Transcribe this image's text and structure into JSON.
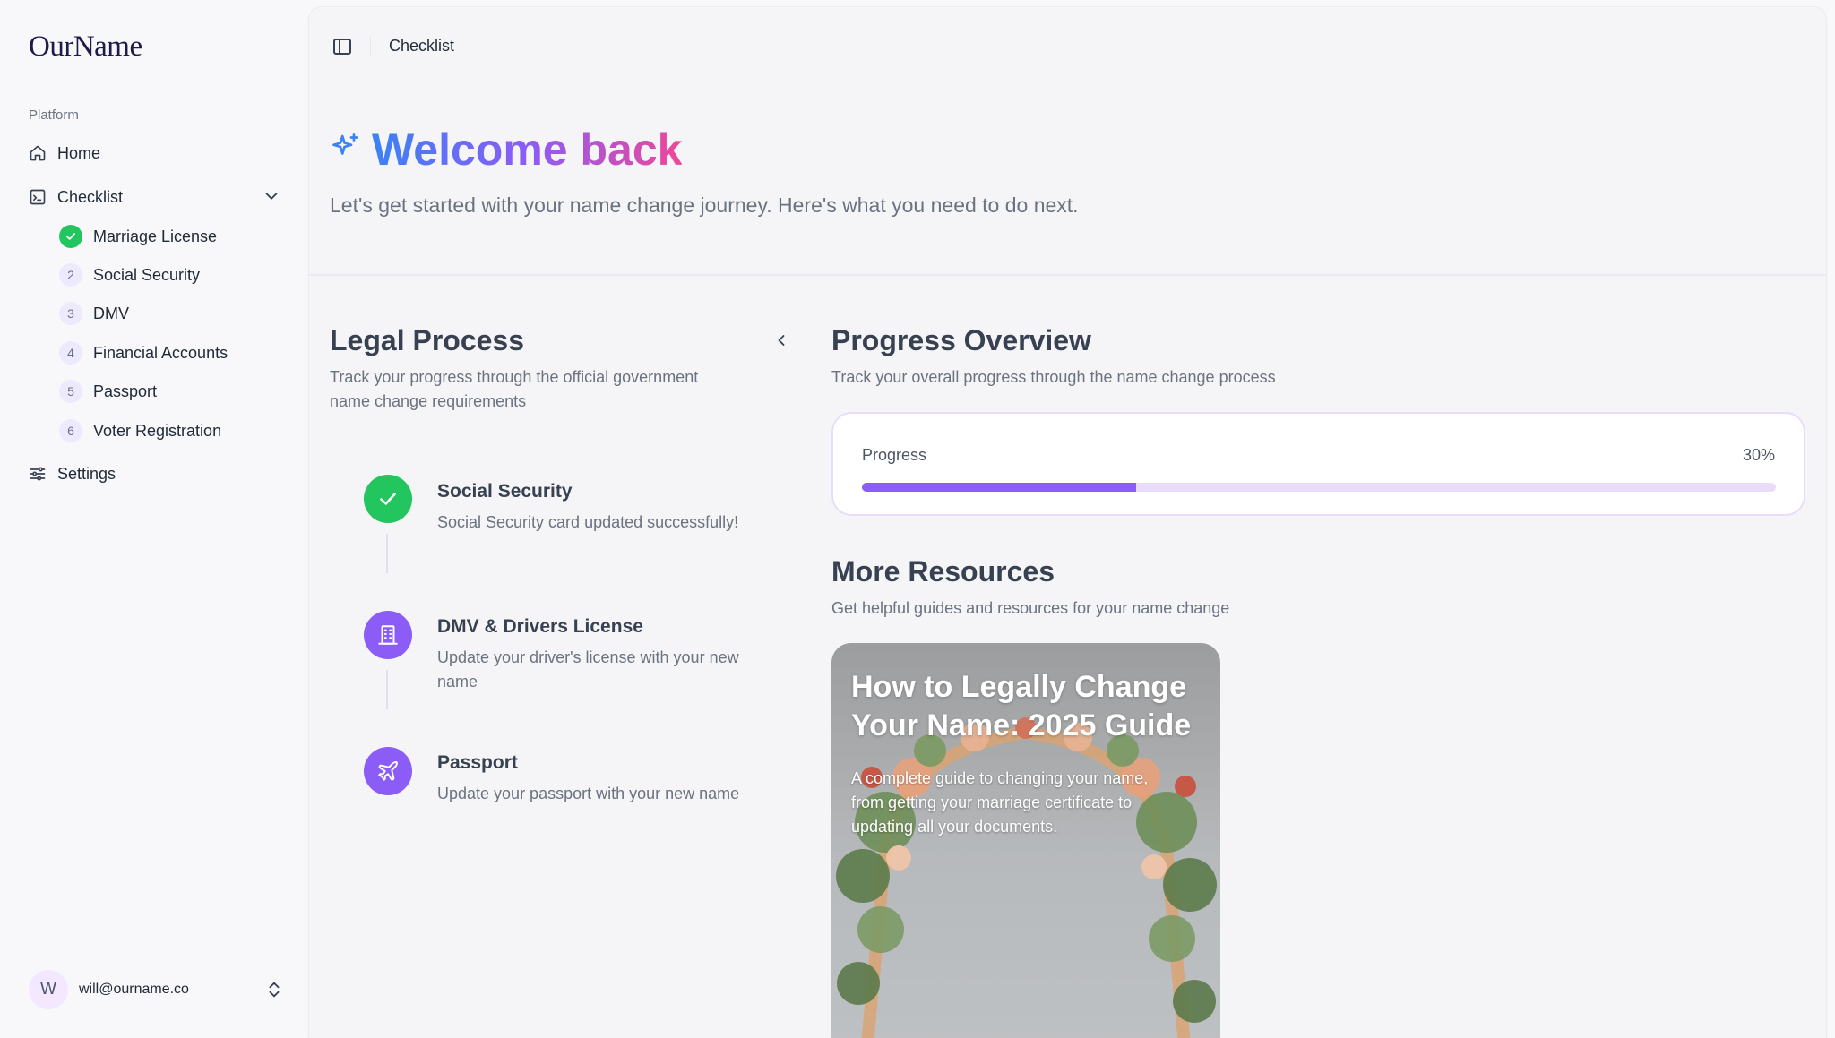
{
  "sidebar": {
    "logo": "OurName",
    "section_label": "Platform",
    "home_label": "Home",
    "checklist_label": "Checklist",
    "checklist_items": [
      {
        "badge": "",
        "label": "Marriage License",
        "done": true
      },
      {
        "badge": "2",
        "label": "Social Security"
      },
      {
        "badge": "3",
        "label": "DMV"
      },
      {
        "badge": "4",
        "label": "Financial Accounts"
      },
      {
        "badge": "5",
        "label": "Passport"
      },
      {
        "badge": "6",
        "label": "Voter Registration"
      }
    ],
    "settings_label": "Settings",
    "user": {
      "initial": "W",
      "email": "will@ourname.co"
    }
  },
  "topbar": {
    "title": "Checklist"
  },
  "welcome": {
    "title": "Welcome back",
    "subtitle": "Let's get started with your name change journey. Here's what you need to do next."
  },
  "legal": {
    "title": "Legal Process",
    "description": "Track your progress through the official government name change requirements",
    "steps": [
      {
        "title": "Social Security",
        "description": "Social Security card updated successfully!",
        "icon": "check-icon",
        "status": "complete"
      },
      {
        "title": "DMV & Drivers License",
        "description": "Update your driver's license with your new name",
        "icon": "building-icon",
        "status": "pending"
      },
      {
        "title": "Passport",
        "description": "Update your passport with your new name",
        "icon": "plane-icon",
        "status": "pending"
      }
    ]
  },
  "progress": {
    "title": "Progress Overview",
    "description": "Track your overall progress through the name change process",
    "label": "Progress",
    "value_text": "30%",
    "value": 0.3
  },
  "resources": {
    "title": "More Resources",
    "description": "Get helpful guides and resources for your name change",
    "cards": [
      {
        "title": "How to Legally Change Your Name: 2025 Guide",
        "description": "A complete guide to changing your name, from getting your marriage certificate to updating all your documents."
      }
    ]
  },
  "colors": {
    "accent": "#8b5cf6",
    "accent_light": "#e9dcfb",
    "success": "#22c55e",
    "gradient_start": "#3b82f6",
    "gradient_end": "#ec4899"
  }
}
